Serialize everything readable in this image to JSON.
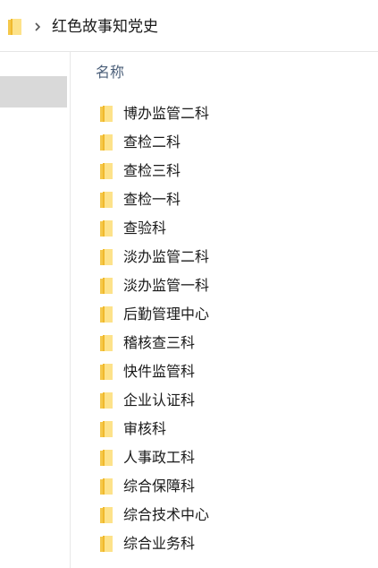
{
  "address_bar": {
    "icon": "folder-icon",
    "separator_icon": "chevron-right-icon",
    "path": "红色故事知党史"
  },
  "list_header": {
    "name_column": "名称"
  },
  "colors": {
    "folder_yellow": "#f5c84a",
    "folder_light": "#fde28a",
    "header_text": "#4c607a",
    "nav_selected": "#d9d9d9"
  },
  "files": [
    {
      "name": "博办监管二科",
      "icon": "folder-icon"
    },
    {
      "name": "查检二科",
      "icon": "folder-icon"
    },
    {
      "name": "查检三科",
      "icon": "folder-icon"
    },
    {
      "name": "查检一科",
      "icon": "folder-icon"
    },
    {
      "name": "查验科",
      "icon": "folder-icon"
    },
    {
      "name": "淡办监管二科",
      "icon": "folder-icon"
    },
    {
      "name": "淡办监管一科",
      "icon": "folder-icon"
    },
    {
      "name": "后勤管理中心",
      "icon": "folder-icon"
    },
    {
      "name": "稽核查三科",
      "icon": "folder-icon"
    },
    {
      "name": "快件监管科",
      "icon": "folder-icon"
    },
    {
      "name": "企业认证科",
      "icon": "folder-icon"
    },
    {
      "name": "审核科",
      "icon": "folder-icon"
    },
    {
      "name": "人事政工科",
      "icon": "folder-icon"
    },
    {
      "name": "综合保障科",
      "icon": "folder-icon"
    },
    {
      "name": "综合技术中心",
      "icon": "folder-icon"
    },
    {
      "name": "综合业务科",
      "icon": "folder-icon"
    }
  ]
}
